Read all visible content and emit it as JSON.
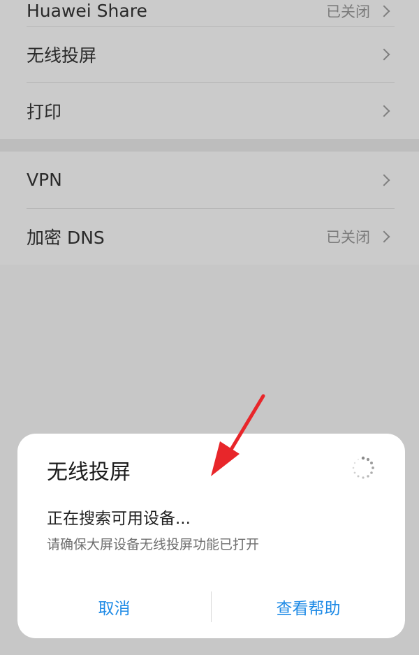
{
  "settings": {
    "group1": [
      {
        "label": "Huawei Share",
        "value": "已关闭"
      },
      {
        "label": "无线投屏",
        "value": ""
      },
      {
        "label": "打印",
        "value": ""
      }
    ],
    "group2": [
      {
        "label": "VPN",
        "value": ""
      },
      {
        "label": "加密 DNS",
        "value": "已关闭"
      }
    ]
  },
  "dialog": {
    "title": "无线投屏",
    "status": "正在搜索可用设备...",
    "hint": "请确保大屏设备无线投屏功能已打开",
    "cancel_label": "取消",
    "help_label": "查看帮助"
  },
  "colors": {
    "accent": "#1d8ae6",
    "annotation_arrow": "#e8262a"
  },
  "icons": {
    "spinner": "loading-spinner-icon",
    "chevron": "chevron-right-icon",
    "annotation": "red-arrow-annotation"
  }
}
